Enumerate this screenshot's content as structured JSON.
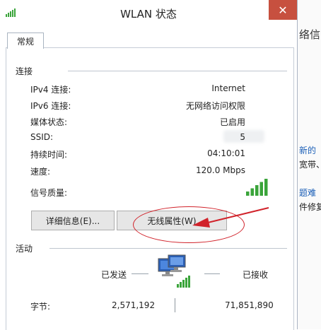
{
  "window": {
    "title": "WLAN 状态",
    "close_glyph": "✕"
  },
  "tabs": [
    {
      "label": "常规"
    }
  ],
  "connection": {
    "group_title": "连接",
    "rows": [
      {
        "label": "IPv4 连接:",
        "value": "Internet"
      },
      {
        "label": "IPv6 连接:",
        "value": "无网络访问权限"
      },
      {
        "label": "媒体状态:",
        "value": "已启用"
      },
      {
        "label": "SSID:",
        "value": "5"
      },
      {
        "label": "持续时间:",
        "value": "04:10:01"
      },
      {
        "label": "速度:",
        "value": "120.0 Mbps"
      }
    ],
    "signal_label": "信号质量:",
    "signal_bars": 5,
    "signal_max": 5
  },
  "buttons": {
    "details": "详细信息(E)...",
    "wireless_properties": "无线属性(W)"
  },
  "activity": {
    "group_title": "活动",
    "sent_label": "已发送",
    "received_label": "已接收",
    "bytes_label": "字节:",
    "bytes_sent": "2,571,192",
    "bytes_received": "71,851,890"
  },
  "background_window": {
    "heading": "络信",
    "link1": "新的",
    "text1": "宽带、",
    "link2": "题难",
    "text2": "件修复"
  },
  "colors": {
    "accent_red": "#d1232b",
    "close_red": "#c7503f",
    "signal_green": "#3aa43a",
    "link_blue": "#1b5fb7"
  },
  "icons": [
    "wifi-signal-icon",
    "close-icon",
    "network-computers-icon",
    "red-arrow-annotation",
    "red-ellipse-annotation"
  ]
}
